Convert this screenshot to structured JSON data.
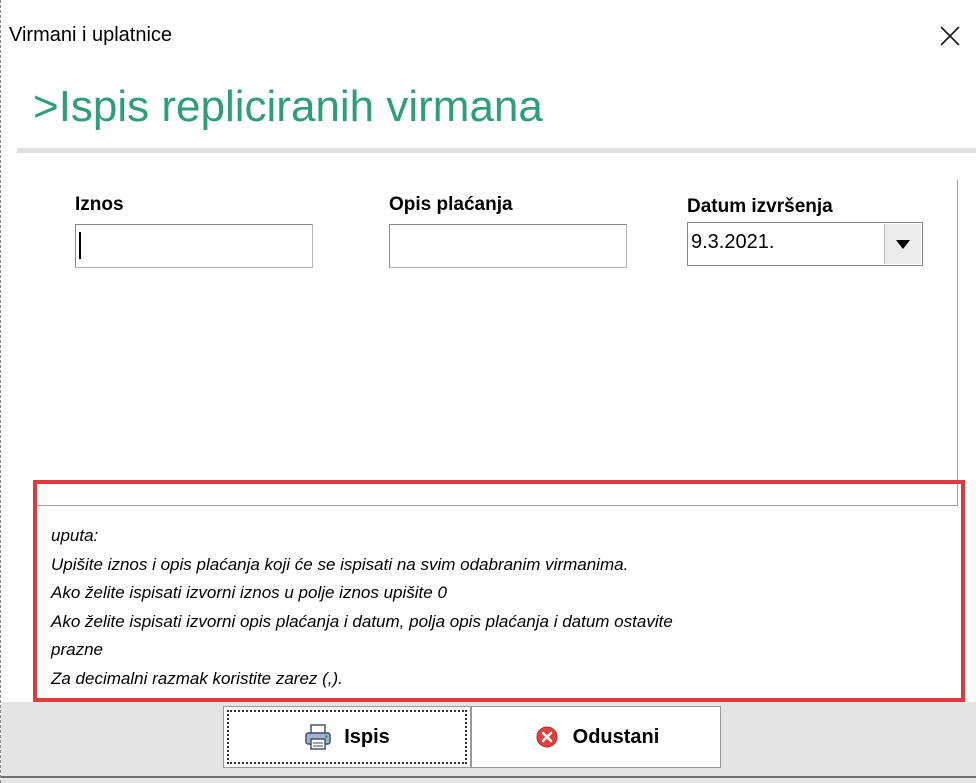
{
  "window": {
    "title": "Virmani i uplatnice"
  },
  "heading": {
    "text": ">Ispis repliciranih virmana"
  },
  "form": {
    "iznos": {
      "label": "Iznos",
      "value": ""
    },
    "opis": {
      "label": "Opis plaćanja",
      "value": ""
    },
    "datum": {
      "label": "Datum izvršenja",
      "value": "9.3.2021."
    }
  },
  "info": {
    "lines": [
      "uputa:",
      "Upišite iznos i opis plaćanja koji će se ispisati na svim odabranim virmanima.",
      "Ako želite ispisati izvorni iznos u polje iznos upišite 0",
      "Ako želite ispisati izvorni opis plaćanja i datum, polja opis plaćanja i datum ostavite",
      "prazne",
      "Za decimalni razmak koristite zarez (,)."
    ]
  },
  "buttons": {
    "ispis": {
      "label": "Ispis",
      "icon": "printer-icon"
    },
    "odustani": {
      "label": "Odustani",
      "icon": "cancel-circle-icon"
    }
  },
  "colors": {
    "heading": "#2e9e7a",
    "highlight_border": "#e03a3e",
    "cancel_icon": "#e0413c"
  }
}
